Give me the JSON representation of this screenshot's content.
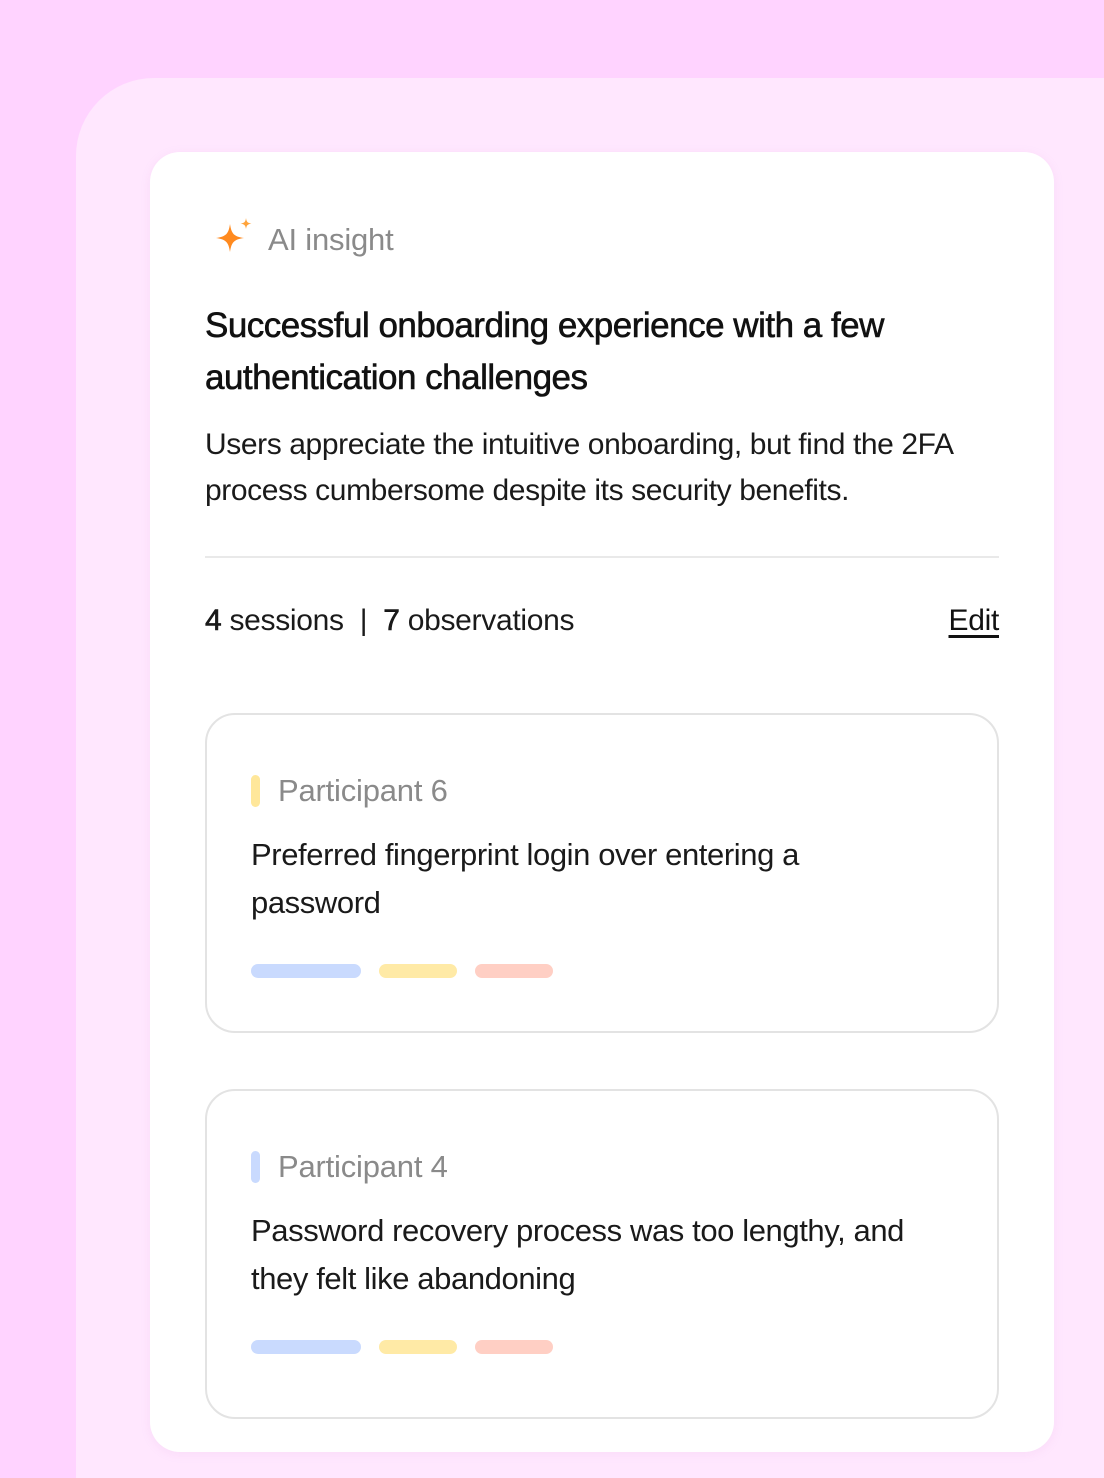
{
  "colors": {
    "page_bg": "#ffd3ff",
    "panel_bg": "#ffe7fe",
    "card_bg": "#ffffff",
    "spark_orange": "#ff8a1f",
    "tag_blue": "#c9dafe",
    "tag_yellow": "#ffeaa6",
    "tag_salmon": "#ffcfc4"
  },
  "header": {
    "icon": "sparkle-icon",
    "label": "AI insight"
  },
  "insight": {
    "title": "Successful onboarding experience with a few authentication challenges",
    "summary": "Users appreciate the intuitive onboarding, but find the 2FA process cumbersome despite its security benefits."
  },
  "stats": {
    "sessions_count": "4",
    "sessions_label": "sessions",
    "separator": "|",
    "observations_count": "7",
    "observations_label": "observations",
    "edit_label": "Edit"
  },
  "observations": [
    {
      "participant": "Participant 6",
      "marker_color": "#ffe79a",
      "text": "Preferred fingerprint login over entering a password",
      "tags": [
        "#c9dafe",
        "#ffeaa6",
        "#ffcfc4"
      ]
    },
    {
      "participant": "Participant 4",
      "marker_color": "#c9dafe",
      "text": "Password recovery process was too lengthy, and they felt like abandoning",
      "tags": [
        "#c9dafe",
        "#ffeaa6",
        "#ffcfc4"
      ]
    }
  ]
}
